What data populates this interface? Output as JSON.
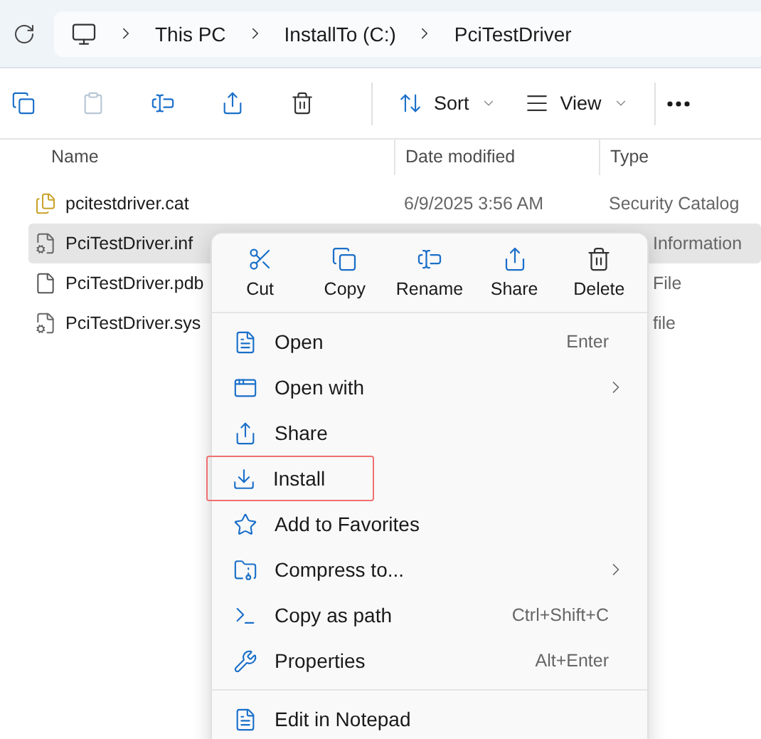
{
  "breadcrumb": [
    "This PC",
    "InstallTo (C:)",
    "PciTestDriver"
  ],
  "toolbar": {
    "sort": "Sort",
    "view": "View"
  },
  "columns": [
    "Name",
    "Date modified",
    "Type"
  ],
  "files": [
    {
      "name": "pcitestdriver.cat",
      "date": "6/9/2025 3:56 AM",
      "type": "Security Catalog",
      "selected": false,
      "covered": false
    },
    {
      "name": "PciTestDriver.inf",
      "type": "Information",
      "selected": true,
      "covered": true
    },
    {
      "name": "PciTestDriver.pdb",
      "type": "File",
      "selected": false,
      "covered": true
    },
    {
      "name": "PciTestDriver.sys",
      "type": "file",
      "selected": false,
      "covered": true
    }
  ],
  "context_menu": {
    "actions": [
      "Cut",
      "Copy",
      "Rename",
      "Share",
      "Delete"
    ],
    "sections": [
      [
        {
          "label": "Open",
          "shortcut": "Enter",
          "submenu": false,
          "highlighted": false
        },
        {
          "label": "Open with",
          "submenu": true,
          "highlighted": false
        },
        {
          "label": "Share",
          "submenu": false,
          "highlighted": false
        },
        {
          "label": "Install",
          "submenu": false,
          "highlighted": true
        },
        {
          "label": "Add to Favorites",
          "submenu": false,
          "highlighted": false
        },
        {
          "label": "Compress to...",
          "submenu": true,
          "highlighted": false
        },
        {
          "label": "Copy as path",
          "shortcut": "Ctrl+Shift+C",
          "submenu": false,
          "highlighted": false
        },
        {
          "label": "Properties",
          "shortcut": "Alt+Enter",
          "submenu": false,
          "highlighted": false
        }
      ],
      [
        {
          "label": "Edit in Notepad",
          "submenu": false,
          "highlighted": false
        }
      ]
    ]
  }
}
